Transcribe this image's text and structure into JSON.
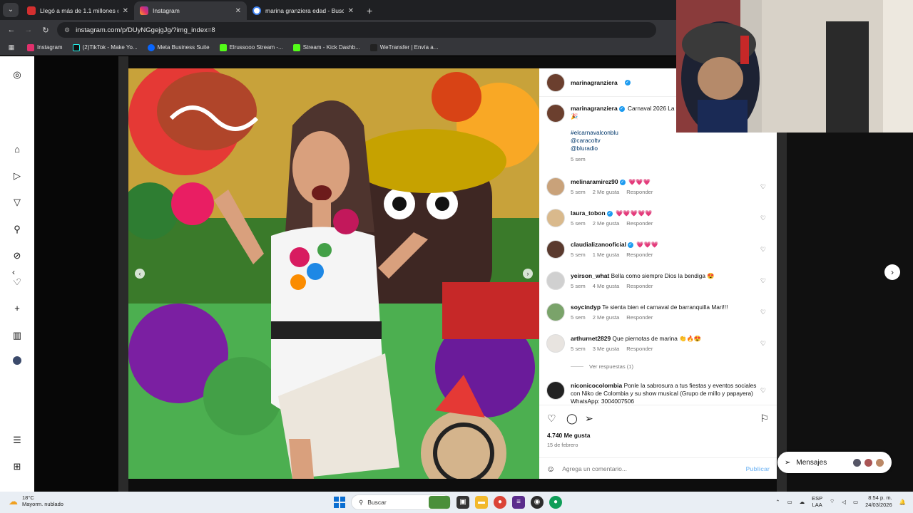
{
  "browser": {
    "tabs": [
      {
        "title": "Llegó a más de 1.1 millones de",
        "favicon_color": "#d32f2f",
        "active": false
      },
      {
        "title": "Instagram",
        "favicon_color": "#e1306c",
        "active": true
      },
      {
        "title": "marina granziera edad - Buscar",
        "favicon_color": "#4285f4",
        "active": false
      }
    ],
    "new_tab": "+",
    "url": "instagram.com/p/DUyNGgejgJg/?img_index=8",
    "bookmarks": [
      {
        "label": "Instagram",
        "color": "#e1306c"
      },
      {
        "label": "(2)TikTok - Make Yo...",
        "color": "#111111"
      },
      {
        "label": "Meta Business Suite",
        "color": "#0866ff"
      },
      {
        "label": "Elrussooo Stream -...",
        "color": "#53fc18"
      },
      {
        "label": "Stream - Kick Dashb...",
        "color": "#53fc18"
      },
      {
        "label": "WeTransfer | Envía a...",
        "color": "#222222"
      }
    ]
  },
  "post": {
    "username": "marinagranziera",
    "caption_text": "Carnaval 2026 La familia Caracol Tv y Blu Radio 🎉",
    "caption_tags": [
      "#elcarnavalconblu",
      "@caracoltv",
      "@bluradio"
    ],
    "caption_time": "5 sem",
    "likes": "4.740 Me gusta",
    "date": "15 de febrero",
    "comment_placeholder": "Agrega un comentario...",
    "publish_label": "Publicar",
    "view_replies": "Ver respuestas (1)"
  },
  "comments": [
    {
      "user": "melinaramirez90",
      "verified": true,
      "text": "",
      "hearts": "💗💗💗",
      "time": "5 sem",
      "likes": "2 Me gusta",
      "reply": "Responder",
      "avatar_color": "#c9a27a"
    },
    {
      "user": "laura_tobon",
      "verified": true,
      "text": "",
      "hearts": "💗💗💗💗💗",
      "time": "5 sem",
      "likes": "2 Me gusta",
      "reply": "Responder",
      "avatar_color": "#d9b98c"
    },
    {
      "user": "claudializanooficial",
      "verified": true,
      "text": "",
      "hearts": "💗💗💗",
      "time": "5 sem",
      "likes": "1 Me gusta",
      "reply": "Responder",
      "avatar_color": "#5a3a2e"
    },
    {
      "user": "yeirson_what",
      "verified": false,
      "text": "Bella como siempre Dios la bendiga 😍",
      "hearts": "",
      "time": "5 sem",
      "likes": "4 Me gusta",
      "reply": "Responder",
      "avatar_color": "#d0d0d0"
    },
    {
      "user": "soycindyp",
      "verified": false,
      "text": "Te sienta bien el carnaval de barranquilla Mari!!!",
      "hearts": "",
      "time": "5 sem",
      "likes": "2 Me gusta",
      "reply": "Responder",
      "avatar_color": "#7aa36a"
    },
    {
      "user": "arthurnet2829",
      "verified": false,
      "text": "Que piernotas de marina 👏🔥😍",
      "hearts": "",
      "time": "5 sem",
      "likes": "3 Me gusta",
      "reply": "Responder",
      "avatar_color": "#e8e4e0"
    },
    {
      "user": "niconicocolombia",
      "verified": false,
      "text": "Ponle la sabrosura a tus fiestas y eventos sociales con Niko de Colombia y su show musical (Grupo de millo y papayera) WhatsApp: 3004007506",
      "hearts": "",
      "time": "",
      "likes": "",
      "reply": "",
      "avatar_color": "#222222"
    }
  ],
  "messages": {
    "label": "Mensajes"
  },
  "taskbar": {
    "weather_temp": "18°C",
    "weather_desc": "Mayorm. nublado",
    "search": "Buscar",
    "lang_top": "ESP",
    "lang_bottom": "LAA",
    "time": "8:54 p. m.",
    "date": "24/03/2026"
  }
}
